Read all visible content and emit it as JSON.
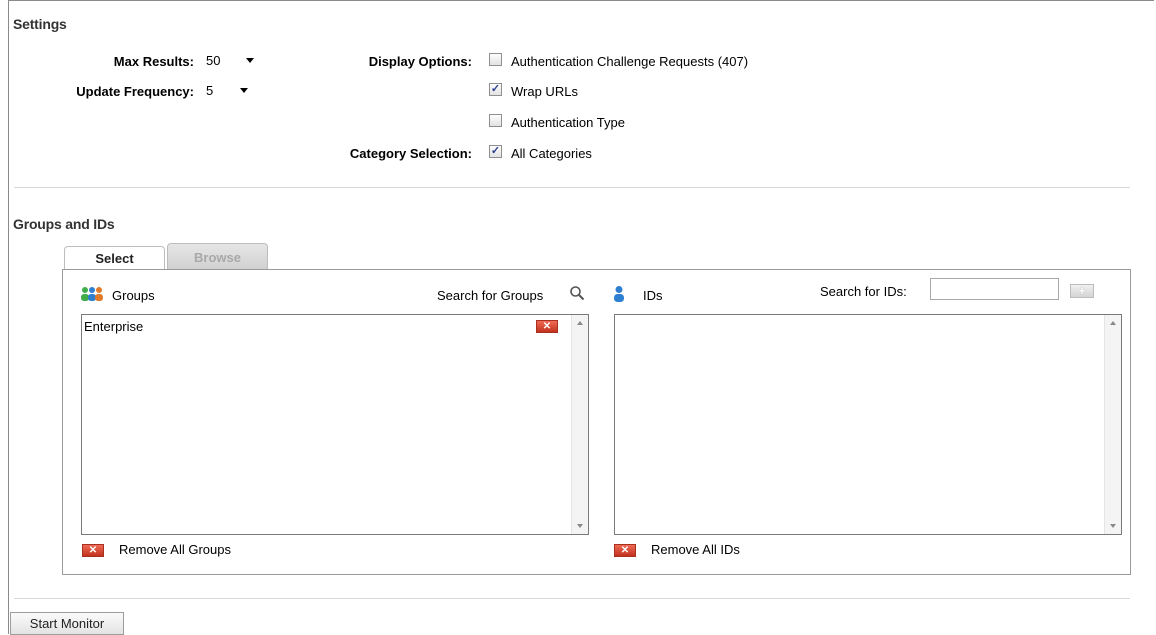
{
  "settings": {
    "title": "Settings",
    "max_results": {
      "label": "Max Results:",
      "value": "50"
    },
    "update_frequency": {
      "label": "Update Frequency:",
      "value": "5"
    },
    "display_options": {
      "label": "Display Options:",
      "items": [
        {
          "label": "Authentication Challenge Requests (407)",
          "checked": false
        },
        {
          "label": "Wrap URLs",
          "checked": true
        },
        {
          "label": "Authentication Type",
          "checked": false
        }
      ]
    },
    "category_selection": {
      "label": "Category Selection:",
      "item_label": "All Categories",
      "checked": true
    }
  },
  "groups_ids": {
    "title": "Groups and IDs",
    "tabs": [
      {
        "label": "Select",
        "active": true
      },
      {
        "label": "Browse",
        "active": false
      }
    ],
    "groups": {
      "heading": "Groups",
      "search_label": "Search for Groups",
      "items": [
        "Enterprise"
      ],
      "remove_all_label": "Remove All Groups"
    },
    "ids": {
      "heading": "IDs",
      "search_label": "Search for IDs:",
      "search_value": "",
      "items": [],
      "remove_all_label": "Remove All IDs"
    }
  },
  "actions": {
    "start_monitor_label": "Start Monitor"
  },
  "icons": {
    "groups": "people-group-icon",
    "search": "magnifier-icon",
    "ids": "person-icon",
    "remove": "red-x-icon",
    "add": "plus-icon"
  },
  "colors": {
    "remove_red": "#d9442e",
    "person_blue": "#2f7fd1",
    "group_green": "#3fae49",
    "group_orange": "#e07a2b"
  }
}
